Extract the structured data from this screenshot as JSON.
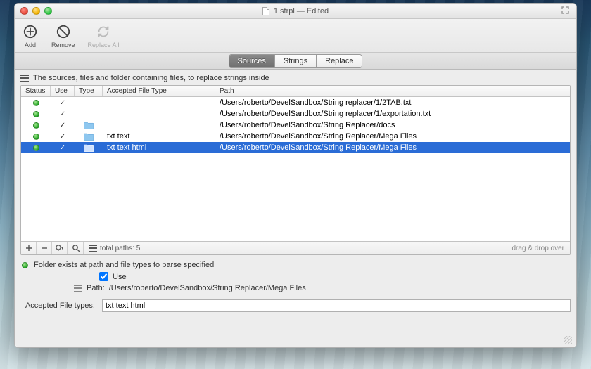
{
  "window": {
    "title": "1.strpl — Edited"
  },
  "toolbar": {
    "add": "Add",
    "remove": "Remove",
    "replace_all": "Replace All"
  },
  "tabs": {
    "sources": "Sources",
    "strings": "Strings",
    "replace": "Replace",
    "active": "sources"
  },
  "description": "The sources, files and folder containing files, to replace strings inside",
  "columns": {
    "status": "Status",
    "use": "Use",
    "type": "Type",
    "accepted": "Accepted File Type",
    "path": "Path"
  },
  "rows": [
    {
      "status": "green",
      "use": true,
      "type": "none",
      "accepted": "",
      "path": "/Users/roberto/DevelSandbox/String replacer/1/2TAB.txt",
      "selected": false
    },
    {
      "status": "green",
      "use": true,
      "type": "none",
      "accepted": "",
      "path": "/Users/roberto/DevelSandbox/String replacer/1/exportation.txt",
      "selected": false
    },
    {
      "status": "green",
      "use": true,
      "type": "folder",
      "accepted": "",
      "path": "/Users/roberto/DevelSandbox/String Replacer/docs",
      "selected": false
    },
    {
      "status": "green",
      "use": true,
      "type": "folder",
      "accepted": "txt text",
      "path": "/Users/roberto/DevelSandbox/String Replacer/Mega Files",
      "selected": false
    },
    {
      "status": "green",
      "use": true,
      "type": "folder",
      "accepted": "txt text html",
      "path": "/Users/roberto/DevelSandbox/String Replacer/Mega Files",
      "selected": true
    }
  ],
  "footer": {
    "total_paths": "total paths: 5",
    "drag_hint": "drag & drop over"
  },
  "detail": {
    "status_text": "Folder exists at path and file types to parse specified",
    "use_label": "Use",
    "use_checked": true,
    "path_label": "Path:",
    "path_value": "/Users/roberto/DevelSandbox/String Replacer/Mega Files",
    "accepted_label": "Accepted File types:",
    "accepted_value": "txt text html"
  }
}
